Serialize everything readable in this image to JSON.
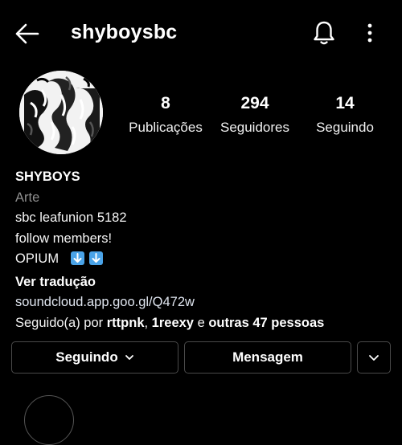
{
  "header": {
    "back_icon": "arrow-left-icon",
    "username": "shyboysbc",
    "bell_icon": "bell-icon",
    "more_icon": "more-vertical-icon"
  },
  "profile": {
    "avatar_icon": "avatar",
    "stats": {
      "posts": {
        "value": "8",
        "label": "Publicações"
      },
      "followers": {
        "value": "294",
        "label": "Seguidores"
      },
      "following": {
        "value": "14",
        "label": "Seguindo"
      }
    }
  },
  "bio": {
    "name": "SHYBOYS",
    "category": "Arte",
    "line1": "sbc leafunion 5182",
    "line2": "follow members!",
    "line3": "OPIUM",
    "line3_emoji": "down-arrow-emoji",
    "translate": "Ver tradução",
    "link": "soundcloud.app.goo.gl/Q472w",
    "followed_prefix": "Seguido(a) por ",
    "followed_user1": "rttpnk",
    "followed_sep": ", ",
    "followed_user2": "1reexy",
    "followed_and": " e ",
    "followed_others": "outras 47 pessoas"
  },
  "actions": {
    "following_label": "Seguindo",
    "message_label": "Mensagem"
  },
  "colors": {
    "background": "#000000",
    "text": "#ffffff",
    "muted": "#8e8e8e",
    "button_border": "#4a4a4a",
    "emoji_blue": "#4aa3e8"
  }
}
